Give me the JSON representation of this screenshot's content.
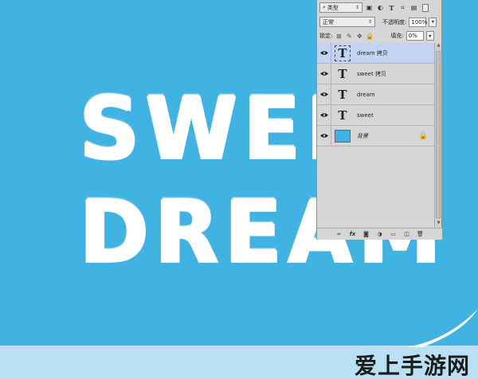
{
  "artwork": {
    "line1": "SWEE",
    "line2": "DREAM"
  },
  "watermark": "爱上手游网",
  "colors": {
    "canvas": "#41b3e3",
    "text": "#ffffff",
    "panel": "#d6d6d6",
    "selected_layer": "#c3d3f2",
    "watermark_strip": "#b9e0f3"
  },
  "layers_panel": {
    "filter": {
      "kind_label": "类型",
      "icons": [
        "filter-search-icon",
        "pixel-layer-filter-icon",
        "adjustment-filter-icon",
        "type-filter-icon",
        "shape-filter-icon",
        "smart-object-filter-icon"
      ]
    },
    "blend_mode": "正常",
    "opacity_label": "不透明度:",
    "opacity_value": "100%",
    "lock_label": "锁定:",
    "fill_label": "填充:",
    "fill_value": "0%",
    "layers": [
      {
        "name": "dream 拷贝",
        "type": "text",
        "selected": true,
        "visible": true
      },
      {
        "name": "sweet 拷贝",
        "type": "text",
        "selected": false,
        "visible": true
      },
      {
        "name": "dream",
        "type": "text",
        "selected": false,
        "visible": true
      },
      {
        "name": "sweet",
        "type": "text",
        "selected": false,
        "visible": true
      },
      {
        "name": "背景",
        "type": "background",
        "selected": false,
        "visible": true,
        "locked": true
      }
    ],
    "type_glyph": "T",
    "footer_icons": [
      "link-icon",
      "fx-icon",
      "mask-icon",
      "adjustment-icon",
      "group-folder-icon",
      "new-layer-icon",
      "trash-icon"
    ]
  }
}
